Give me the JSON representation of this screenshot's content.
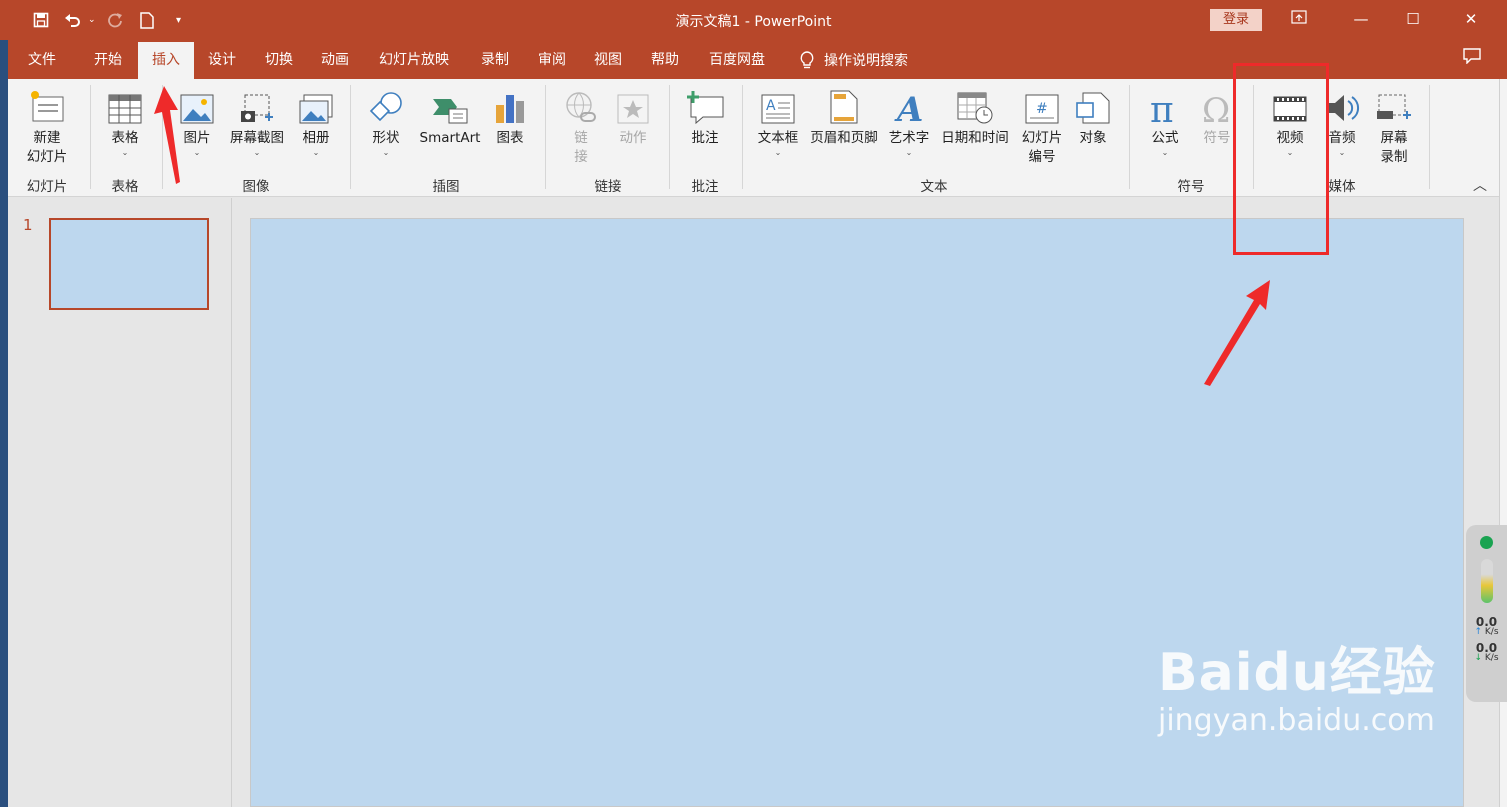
{
  "window": {
    "title": "演示文稿1  -  PowerPoint",
    "login_label": "登录"
  },
  "tabs": [
    "文件",
    "开始",
    "插入",
    "设计",
    "切换",
    "动画",
    "幻灯片放映",
    "录制",
    "审阅",
    "视图",
    "帮助",
    "百度网盘"
  ],
  "active_tab": "插入",
  "tell_me": "操作说明搜索",
  "ribbon": {
    "buttons": {
      "new_slide": "新建\n幻灯片",
      "table": "表格",
      "pictures": "图片",
      "screenshot": "屏幕截图",
      "album": "相册",
      "shapes": "形状",
      "smartart": "SmartArt",
      "chart": "图表",
      "link": "链\n接",
      "action": "动作",
      "comment": "批注",
      "textbox": "文本框",
      "header_footer": "页眉和页脚",
      "wordart": "艺术字",
      "datetime": "日期和时间",
      "slide_number": "幻灯片\n编号",
      "object": "对象",
      "equation": "公式",
      "symbol": "符号",
      "video": "视频",
      "audio": "音频",
      "screen_recording": "屏幕\n录制"
    },
    "groups": {
      "slides": "幻灯片",
      "tables": "表格",
      "images": "图像",
      "illustrations": "插图",
      "links": "链接",
      "comments": "批注",
      "text": "文本",
      "symbols": "符号",
      "media": "媒体"
    }
  },
  "slides_pane": {
    "slide_number": "1"
  },
  "net_widget": {
    "up_value": "0.0",
    "up_unit": "K/s",
    "down_value": "0.0",
    "down_unit": "K/s"
  },
  "watermark": {
    "brand": "Baidu经验",
    "url": "jingyan.baidu.com"
  },
  "colors": {
    "accent": "#b7472a",
    "slide_bg": "#bdd7ee",
    "highlight": "#ee2a2a"
  }
}
